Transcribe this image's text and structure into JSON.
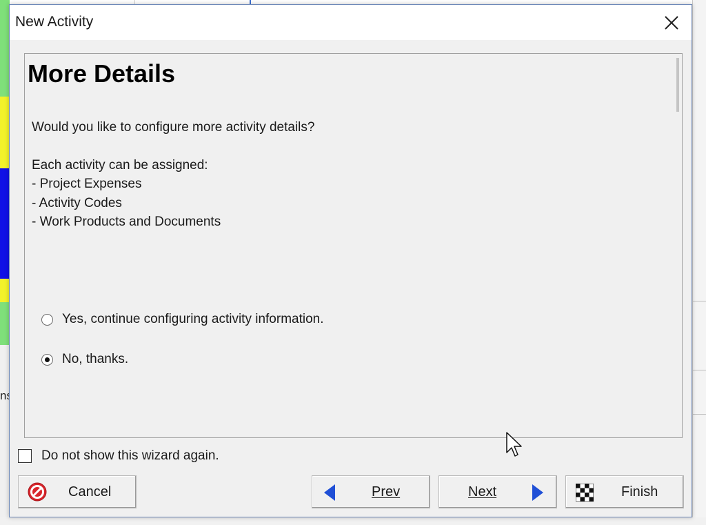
{
  "window": {
    "title": "New Activity"
  },
  "page": {
    "heading": "More Details",
    "question": "Would you like to configure more activity details?",
    "intro": "Each activity can be assigned:",
    "items": [
      "- Project Expenses",
      "- Activity Codes",
      "- Work Products and Documents"
    ]
  },
  "options": [
    {
      "label": "Yes, continue configuring activity information.",
      "selected": false
    },
    {
      "label": "No, thanks.",
      "selected": true
    }
  ],
  "checkbox": {
    "label": "Do not show this wizard again.",
    "checked": false
  },
  "buttons": {
    "cancel": "Cancel",
    "prev": "Prev",
    "next": "Next",
    "finish": "Finish"
  },
  "background": {
    "partial_text": "ns"
  },
  "colors": {
    "accent_blue": "#1f4fd6",
    "cancel_red": "#d9262c",
    "stripe_green": "#7fe07a",
    "stripe_yellow": "#f2f22a",
    "stripe_blue": "#1010e6"
  },
  "icons": {
    "close": "close-icon",
    "cancel": "no-entry-icon",
    "prev": "left-triangle-icon",
    "next": "right-triangle-icon",
    "finish": "checkered-flag-icon"
  }
}
